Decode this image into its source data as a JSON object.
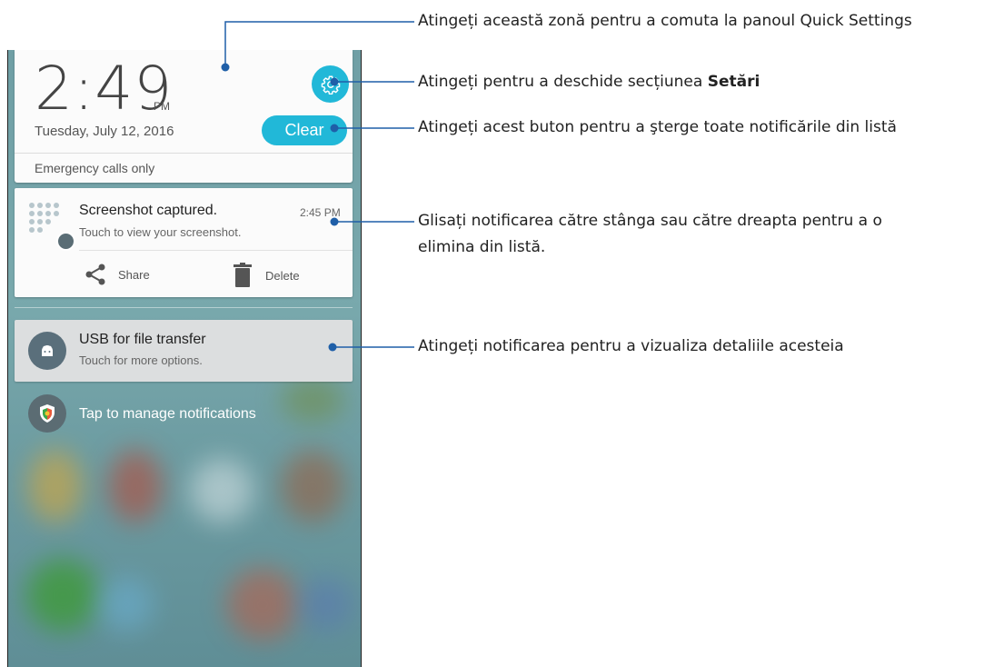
{
  "lockscreen": {
    "time": "2:49",
    "ampm": "PM",
    "date": "Tuesday, July 12, 2016",
    "clear_label": "Clear",
    "emergency": "Emergency calls only"
  },
  "notifications": [
    {
      "title": "Screenshot captured.",
      "subtitle": "Touch to view your screenshot.",
      "time": "2:45 PM",
      "actions": [
        "Share",
        "Delete"
      ]
    },
    {
      "title": "USB for file transfer",
      "subtitle": "Touch for more options."
    }
  ],
  "manage_label": "Tap to manage notifications",
  "callouts": {
    "quick_settings": "Atingeți această zonă pentru a comuta la panoul Quick Settings",
    "settings_prefix": "Atingeți pentru a deschide secțiunea ",
    "settings_bold": "Setări",
    "clear": "Atingeți acest buton pentru a şterge toate notificările din listă",
    "swipe_line1": "Glisați notificarea către stânga sau către dreapta pentru a o",
    "swipe_line2": "elimina din listă.",
    "tap_notif": "Atingeți notificarea pentru a vizualiza detaliile acesteia"
  },
  "colors": {
    "accent": "#21b8d8",
    "callout_line": "#1f5fa8"
  }
}
